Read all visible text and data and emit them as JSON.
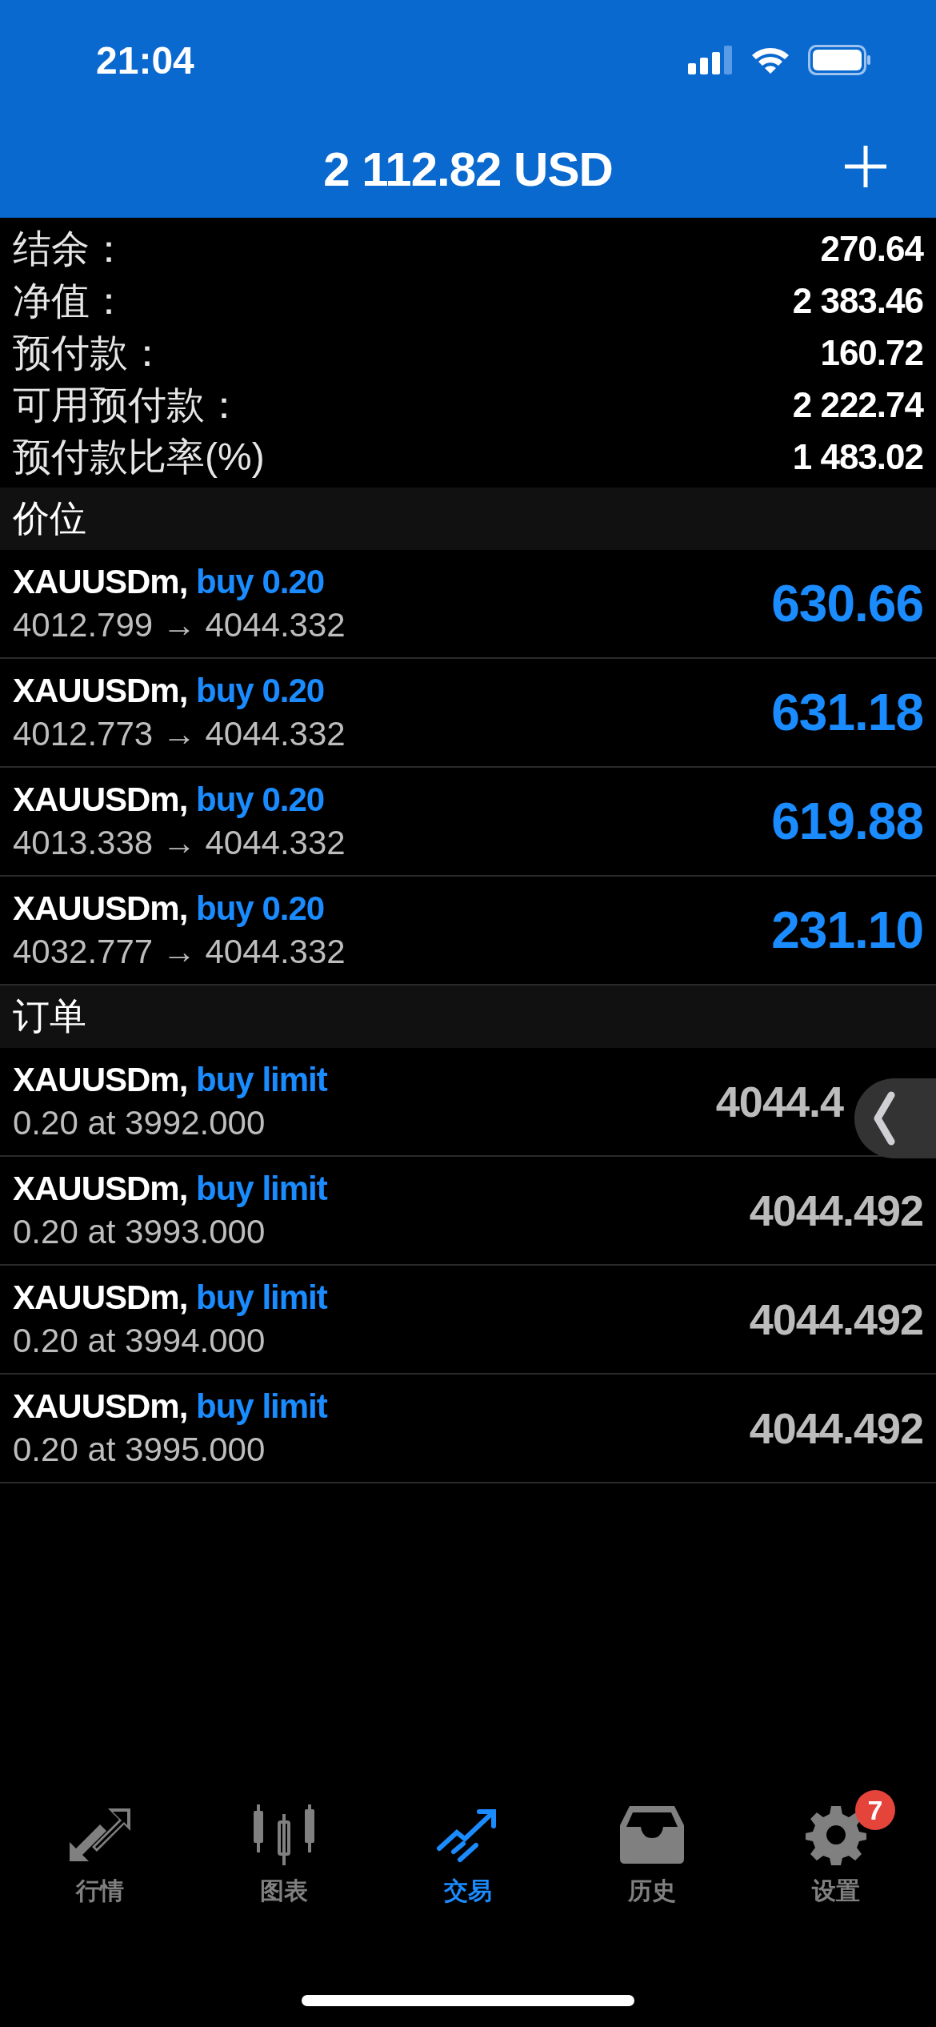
{
  "status_bar": {
    "time": "21:04"
  },
  "header": {
    "title": "2 112.82 USD"
  },
  "summary": [
    {
      "label": "结余：",
      "value": "270.64"
    },
    {
      "label": "净值：",
      "value": "2 383.46"
    },
    {
      "label": "预付款：",
      "value": "160.72"
    },
    {
      "label": "可用预付款：",
      "value": "2 222.74"
    },
    {
      "label": "预付款比率(%)",
      "value": "1 483.02"
    }
  ],
  "positions": {
    "title": "价位",
    "items": [
      {
        "symbol": "XAUUSDm,",
        "action": "buy 0.20",
        "prices": "4012.799 → 4044.332",
        "profit": "630.66"
      },
      {
        "symbol": "XAUUSDm,",
        "action": "buy 0.20",
        "prices": "4012.773 → 4044.332",
        "profit": "631.18"
      },
      {
        "symbol": "XAUUSDm,",
        "action": "buy 0.20",
        "prices": "4013.338 → 4044.332",
        "profit": "619.88"
      },
      {
        "symbol": "XAUUSDm,",
        "action": "buy 0.20",
        "prices": "4032.777 → 4044.332",
        "profit": "231.10"
      }
    ]
  },
  "orders": {
    "title": "订单",
    "items": [
      {
        "symbol": "XAUUSDm,",
        "action": "buy limit",
        "detail": "0.20 at 3992.000",
        "price": "4044.4"
      },
      {
        "symbol": "XAUUSDm,",
        "action": "buy limit",
        "detail": "0.20 at 3993.000",
        "price": "4044.492"
      },
      {
        "symbol": "XAUUSDm,",
        "action": "buy limit",
        "detail": "0.20 at 3994.000",
        "price": "4044.492"
      },
      {
        "symbol": "XAUUSDm,",
        "action": "buy limit",
        "detail": "0.20 at 3995.000",
        "price": "4044.492"
      }
    ]
  },
  "tab_bar": [
    {
      "label": "行情",
      "selected": false
    },
    {
      "label": "图表",
      "selected": false
    },
    {
      "label": "交易",
      "selected": true
    },
    {
      "label": "历史",
      "selected": false
    },
    {
      "label": "设置",
      "selected": false,
      "badge": "7"
    }
  ]
}
